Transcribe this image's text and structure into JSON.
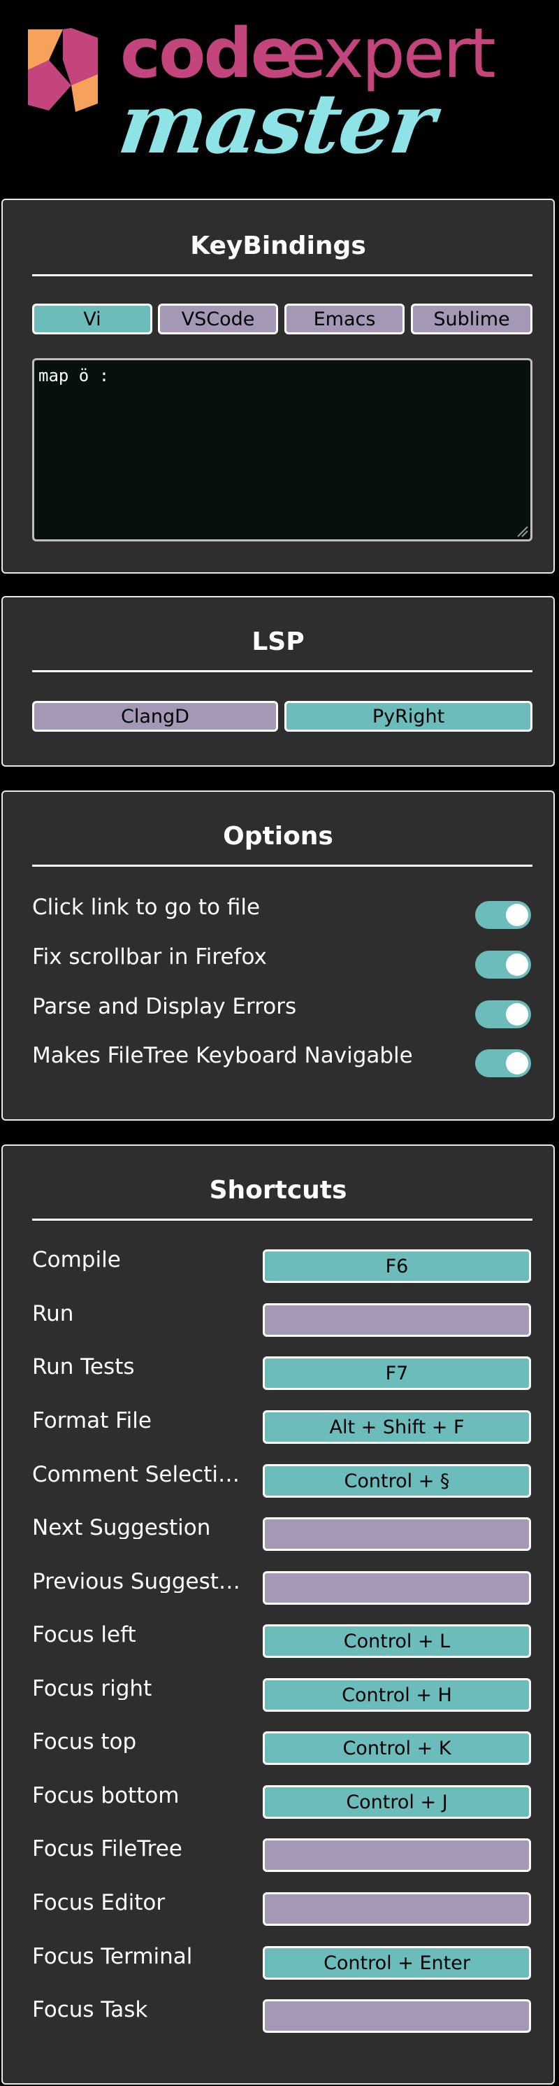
{
  "logo": {
    "word_code": "code",
    "word_expert": "expert",
    "word_master": "master",
    "colors": {
      "pink": "#c4457e",
      "orange": "#f7a25c",
      "cyan": "#8ee3e7"
    }
  },
  "colors": {
    "panel_bg": "#2d2e2d",
    "active_button": "#6dbcbc",
    "inactive_button": "#a498b6",
    "editor_bg": "#06100f"
  },
  "keybindings": {
    "title": "KeyBindings",
    "options": [
      {
        "label": "Vi",
        "active": true
      },
      {
        "label": "VSCode",
        "active": false
      },
      {
        "label": "Emacs",
        "active": false
      },
      {
        "label": "Sublime",
        "active": false
      }
    ],
    "editor_text": "map ö :"
  },
  "lsp": {
    "title": "LSP",
    "options": [
      {
        "label": "ClangD",
        "active": false
      },
      {
        "label": "PyRight",
        "active": true
      }
    ]
  },
  "options": {
    "title": "Options",
    "items": [
      {
        "label": "Click link to go to file",
        "enabled": true
      },
      {
        "label": "Fix scrollbar in Firefox",
        "enabled": true
      },
      {
        "label": "Parse and Display Errors",
        "enabled": true
      },
      {
        "label": "Makes FileTree Keyboard Navigable",
        "enabled": true
      }
    ]
  },
  "shortcuts": {
    "title": "Shortcuts",
    "items": [
      {
        "label": "Compile",
        "key": "F6"
      },
      {
        "label": "Run",
        "key": ""
      },
      {
        "label": "Run Tests",
        "key": "F7"
      },
      {
        "label": "Format File",
        "key": "Alt + Shift + F"
      },
      {
        "label": "Comment Selecti…",
        "key": "Control + §"
      },
      {
        "label": "Next Suggestion",
        "key": ""
      },
      {
        "label": "Previous Suggest…",
        "key": ""
      },
      {
        "label": "Focus left",
        "key": "Control + L"
      },
      {
        "label": "Focus right",
        "key": "Control + H"
      },
      {
        "label": "Focus top",
        "key": "Control + K"
      },
      {
        "label": "Focus bottom",
        "key": "Control + J"
      },
      {
        "label": "Focus FileTree",
        "key": ""
      },
      {
        "label": "Focus Editor",
        "key": ""
      },
      {
        "label": "Focus Terminal",
        "key": "Control + Enter"
      },
      {
        "label": "Focus Task",
        "key": ""
      }
    ]
  }
}
